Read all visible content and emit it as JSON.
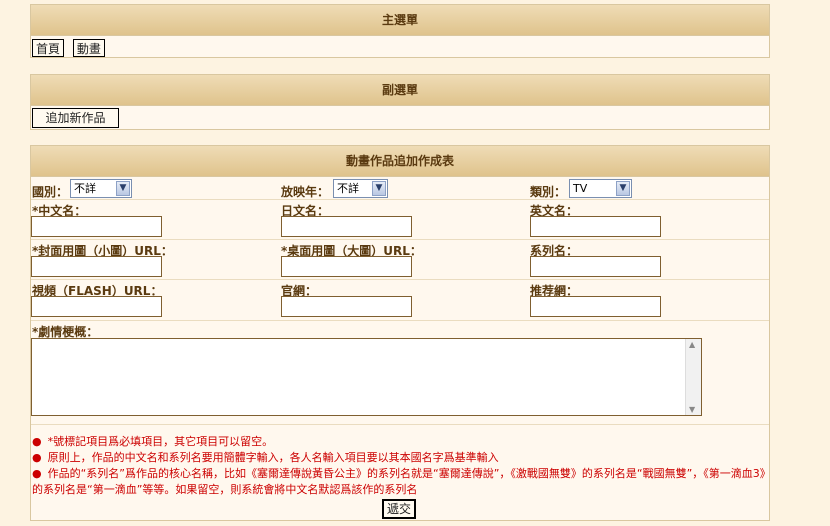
{
  "main_menu": {
    "title": "主選單",
    "items": [
      {
        "label": "首頁"
      },
      {
        "label": "動畫"
      }
    ]
  },
  "sub_menu": {
    "title": "副選單",
    "add_button": "追加新作品"
  },
  "form": {
    "title": "動畫作品追加作成表",
    "country_label": "國別：",
    "country_value": "不詳",
    "year_label": "放映年：",
    "year_value": "不詳",
    "category_label": "類別：",
    "category_value": "TV",
    "chinese_name_label": "*中文名：",
    "japanese_name_label": "日文名：",
    "english_name_label": "英文名：",
    "cover_small_label": "*封面用圖（小圖）URL：",
    "desktop_large_label": "*桌面用圖（大圖）URL：",
    "series_name_label": "系列名：",
    "video_label": "視頻（FLASH）URL：",
    "official_site_label": "官網：",
    "recommended_site_label": "推荐網：",
    "synopsis_label": "*劇情梗概：",
    "notes": [
      "*號標記項目爲必填項目，其它項目可以留空。",
      "原則上，作品的中文名和系列名要用簡體字輸入，各人名輸入項目要以其本國名字爲基準輸入",
      "作品的“系列名”爲作品的核心名稱，比如《塞爾達傳說黃昏公主》的系列名就是“塞爾達傳說”，《激戰國無雙》的系列名是“戰國無雙”，《第一滴血3》的系列名是“第一滴血”等等。如果留空，則系統會將中文名默認爲該作的系列名"
    ],
    "submit_label": "遞交"
  }
}
